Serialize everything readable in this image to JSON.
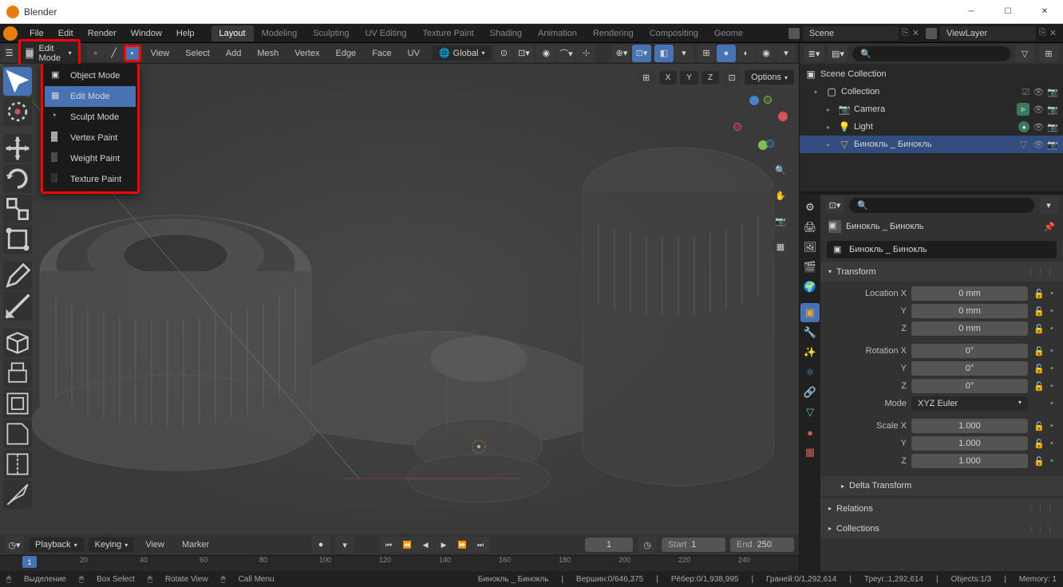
{
  "titlebar": {
    "title": "Blender"
  },
  "topmenu": {
    "items": [
      "File",
      "Edit",
      "Render",
      "Window",
      "Help"
    ]
  },
  "workspaces": {
    "tabs": [
      "Layout",
      "Modeling",
      "Sculpting",
      "UV Editing",
      "Texture Paint",
      "Shading",
      "Animation",
      "Rendering",
      "Compositing",
      "Geome"
    ]
  },
  "scene": {
    "label": "Scene"
  },
  "viewlayer": {
    "label": "ViewLayer"
  },
  "viewport": {
    "mode": "Edit Mode",
    "mode_options": [
      "Object Mode",
      "Edit Mode",
      "Sculpt Mode",
      "Vertex Paint",
      "Weight Paint",
      "Texture Paint"
    ],
    "menus": [
      "View",
      "Select",
      "Add",
      "Mesh",
      "Vertex",
      "Edge",
      "Face",
      "UV"
    ],
    "orientation": "Global",
    "overlay_axes": [
      "X",
      "Y",
      "Z"
    ],
    "options_label": "Options"
  },
  "outliner": {
    "root": "Scene Collection",
    "collection": "Collection",
    "camera": "Camera",
    "light": "Light",
    "object": "Бинокль _ Бинокль"
  },
  "properties": {
    "breadcrumb": "Бинокль _ Бинокль",
    "name": "Бинокль _ Бинокль",
    "transform": {
      "title": "Transform",
      "loc": {
        "x_label": "Location X",
        "y_label": "Y",
        "z_label": "Z",
        "x": "0 mm",
        "y": "0 mm",
        "z": "0 mm"
      },
      "rot": {
        "x_label": "Rotation X",
        "y_label": "Y",
        "z_label": "Z",
        "x": "0°",
        "y": "0°",
        "z": "0°"
      },
      "mode_label": "Mode",
      "mode": "XYZ Euler",
      "scale": {
        "x_label": "Scale X",
        "y_label": "Y",
        "z_label": "Z",
        "x": "1.000",
        "y": "1.000",
        "z": "1.000"
      },
      "delta": "Delta Transform"
    },
    "relations": "Relations",
    "collections": "Collections"
  },
  "timeline": {
    "playback": "Playback",
    "keying": "Keying",
    "view": "View",
    "marker": "Marker",
    "frame": "1",
    "start_label": "Start",
    "start": "1",
    "end_label": "End",
    "end": "250",
    "ticks": [
      "20",
      "40",
      "60",
      "80",
      "100",
      "120",
      "140",
      "160",
      "180",
      "200",
      "220",
      "240"
    ],
    "cursor": "1"
  },
  "statusbar": {
    "select_action": "Выделение",
    "box_action": "Box Select",
    "rotate_action": "Rotate View",
    "menu_action": "Call Menu",
    "object": "Бинокль _ Бинокль",
    "verts": "Вершин:0/646,375",
    "edges": "Рёбер:0/1,938,995",
    "faces": "Граней:0/1,292,614",
    "tris": "Треуг.:1,292,614",
    "objs": "Objects:1/3",
    "mem": "Memory: 1"
  }
}
